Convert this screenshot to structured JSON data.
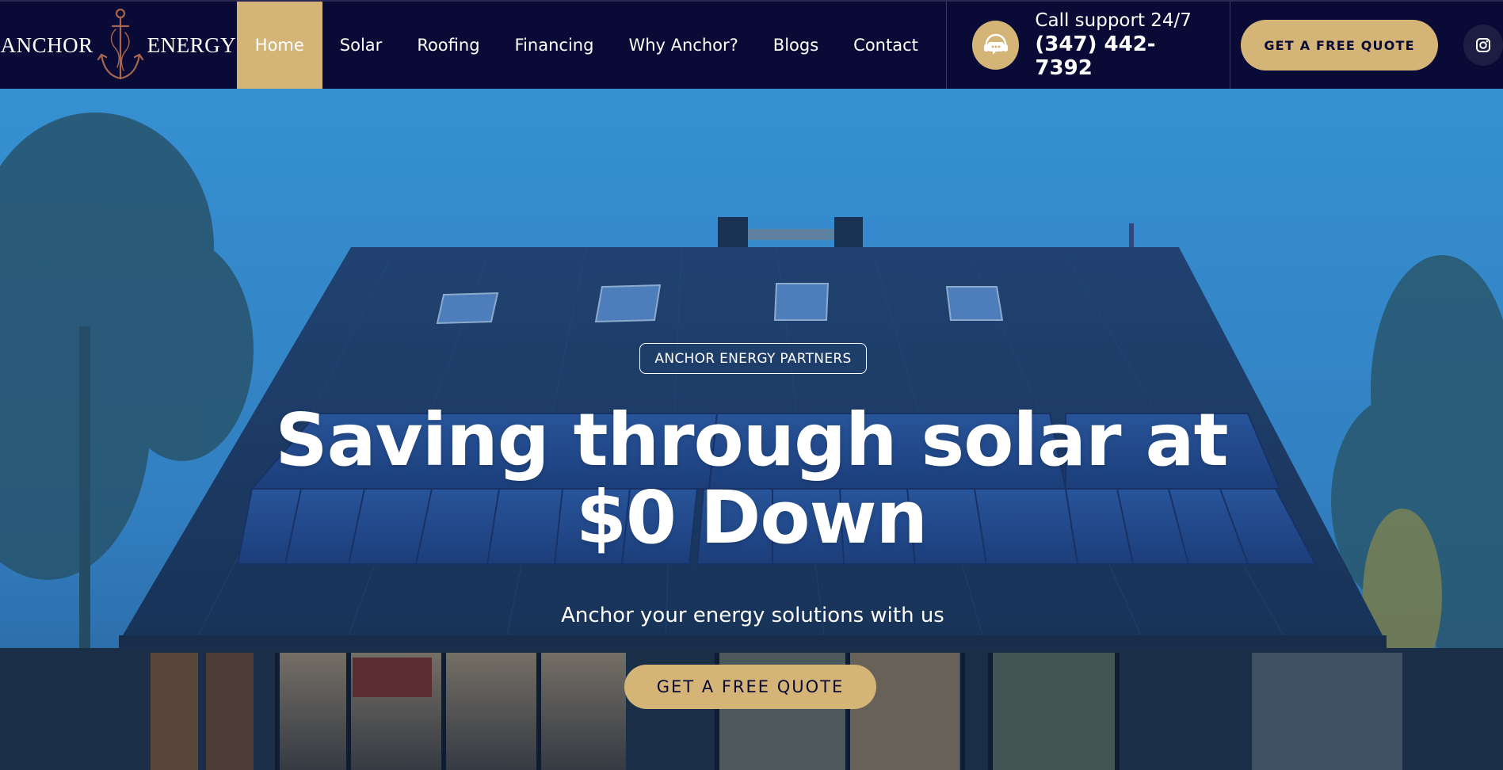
{
  "brand": {
    "word_left": "ANCHOR",
    "word_right": "ENERGY",
    "logo_icon": "anchor-icon"
  },
  "nav": {
    "items": [
      {
        "label": "Home",
        "active": true
      },
      {
        "label": "Solar",
        "active": false
      },
      {
        "label": "Roofing",
        "active": false
      },
      {
        "label": "Financing",
        "active": false
      },
      {
        "label": "Why Anchor?",
        "active": false
      },
      {
        "label": "Blogs",
        "active": false
      },
      {
        "label": "Contact",
        "active": false
      }
    ]
  },
  "support": {
    "icon": "headset-chat-icon",
    "label": "Call support 24/7",
    "phone": "(347) 442-7392"
  },
  "header_cta": {
    "label": "GET A FREE QUOTE"
  },
  "social": {
    "icon": "instagram-icon"
  },
  "hero": {
    "badge": "ANCHOR ENERGY PARTNERS",
    "title_line1": "Saving through solar at",
    "title_line2": "$0 Down",
    "subtitle": "Anchor your energy solutions with us",
    "cta_label": "GET A FREE QUOTE"
  },
  "colors": {
    "navy": "#0a0a36",
    "gold": "#d4b577",
    "sky": "#3a9fe0",
    "white": "#ffffff"
  }
}
